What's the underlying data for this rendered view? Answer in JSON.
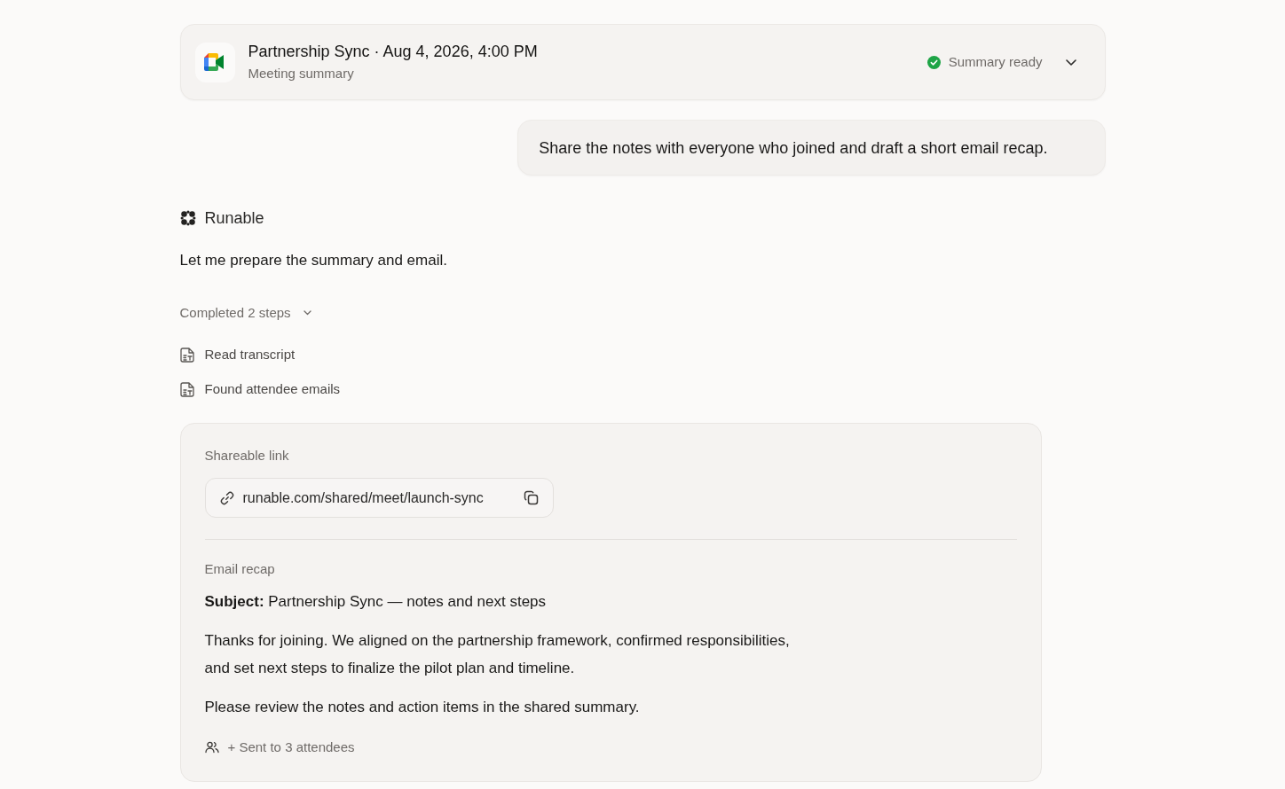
{
  "meeting": {
    "title": "Partnership Sync · Aug 4, 2026, 4:00 PM",
    "subtitle": "Meeting summary",
    "status": {
      "label": "Summary ready",
      "complete": true
    }
  },
  "user_message": {
    "text": "Share the notes with everyone who joined and draft a short email recap."
  },
  "assistant": {
    "name": "Runable",
    "text": "Let me prepare the summary and email.",
    "steps": {
      "label": "Completed 2 steps",
      "expanded": true,
      "items": [
        {
          "label": "Read transcript"
        },
        {
          "label": "Found attendee emails"
        }
      ]
    }
  },
  "result": {
    "link": {
      "label": "Shareable link",
      "url": "runable.com/shared/meet/launch-sync"
    },
    "email": {
      "label": "Email recap",
      "subject": "**Subject:** Partnership Sync — notes and next steps",
      "paragraphs": [
        "Thanks for joining. We aligned on the partnership framework, confirmed responsibilities, and set next steps to finalize the pilot plan and timeline.",
        "Please review the notes and action items in the shared summary."
      ],
      "recipients": "+ Sent to 3 attendees"
    }
  }
}
